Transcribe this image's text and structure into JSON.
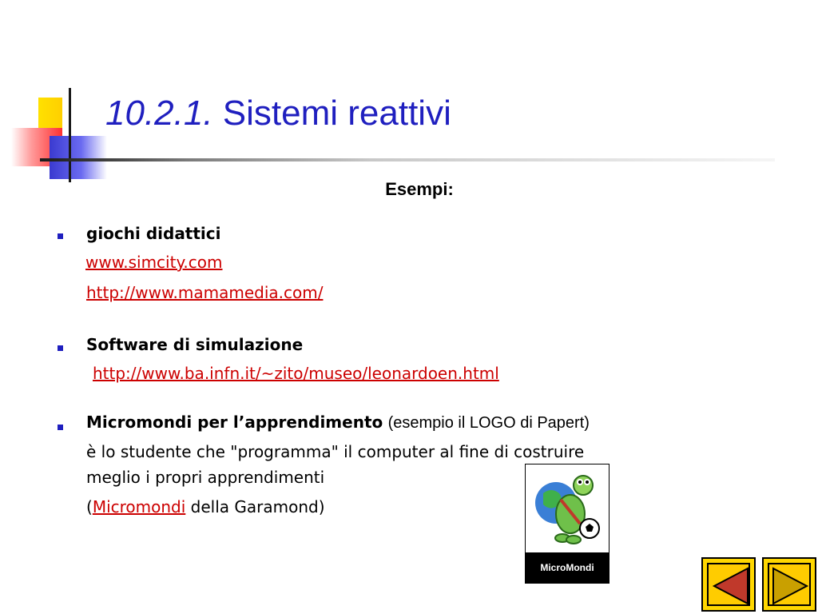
{
  "title": {
    "number": "10.2.1.",
    "text": "Sistemi reattivi"
  },
  "subheading": "Esempi:",
  "sections": [
    {
      "heading": "giochi didattici",
      "links": [
        "www.simcity.com",
        "http://www.mamamedia.com/"
      ]
    },
    {
      "heading": "Software di simulazione",
      "links": [
        "http://www.ba.infn.it/~zito/museo/leonardoen.html"
      ]
    },
    {
      "heading": "Micromondi per l’apprendimento",
      "heading_note": "(esempio il LOGO di Papert)",
      "desc_line1": "è lo studente che \"programma\" il computer al fine di costruire",
      "desc_line2": "meglio i propri apprendimenti",
      "paren_open": "(",
      "link": "Micromondi",
      "paren_rest": " della Garamond)"
    }
  ],
  "image": {
    "label": "MicroMondi"
  },
  "nav": {
    "prev_icon": "triangle-left-icon",
    "next_icon": "triangle-right-icon"
  },
  "colors": {
    "title": "#1f1fbf",
    "link": "#cc0000",
    "bullet": "#1f1fbf",
    "nav": "#ffd700"
  }
}
